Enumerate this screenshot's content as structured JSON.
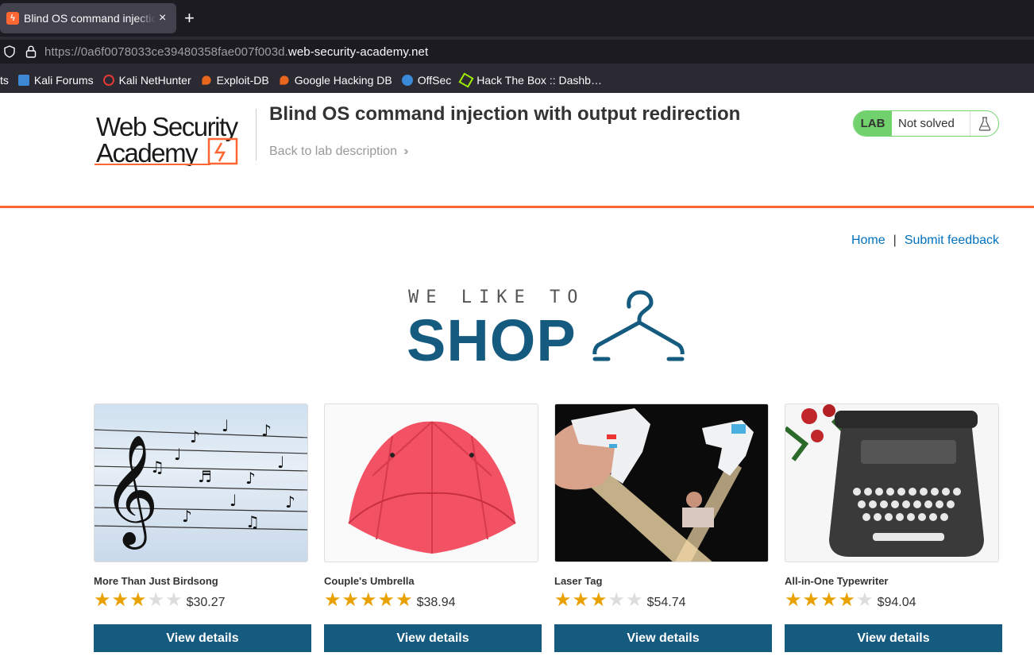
{
  "browser": {
    "tab_title": "Blind OS command injection with output redirection",
    "tab_close": "×",
    "new_tab": "+",
    "url_prefix": "https://0a6f0078033ce39480358fae007f003d.",
    "url_domain": "web-security-academy.net",
    "bookmarks": [
      {
        "label": "Kali Forums",
        "icon": "kali-forums-icon",
        "color": "#3d88d3"
      },
      {
        "label": "Kali NetHunter",
        "icon": "kali-nethunter-icon",
        "color": "#e53935"
      },
      {
        "label": "Exploit-DB",
        "icon": "exploit-db-icon",
        "color": "#e8661d"
      },
      {
        "label": "Google Hacking DB",
        "icon": "google-hacking-db-icon",
        "color": "#e8661d"
      },
      {
        "label": "OffSec",
        "icon": "offsec-icon",
        "color": "#3b8ad8"
      },
      {
        "label": "Hack The Box :: Dashb…",
        "icon": "hack-the-box-icon",
        "color": "#9fef00"
      }
    ],
    "bookmarks_clipped": "ts"
  },
  "lab": {
    "logo_line1": "Web Security",
    "logo_line2": "Academy",
    "title": "Blind OS command injection with output redirection",
    "back_link": "Back to lab description",
    "status_badge": "LAB",
    "status_text": "Not solved",
    "accent": "#ff6633"
  },
  "nav": {
    "home": "Home",
    "separator": "|",
    "feedback": "Submit feedback"
  },
  "banner": {
    "line1": "WE LIKE TO",
    "line2": "SHOP"
  },
  "products": [
    {
      "name": "More Than Just Birdsong",
      "stars": 3,
      "price": "$30.27",
      "button": "View details"
    },
    {
      "name": "Couple's Umbrella",
      "stars": 5,
      "price": "$38.94",
      "button": "View details"
    },
    {
      "name": "Laser Tag",
      "stars": 3,
      "price": "$54.74",
      "button": "View details"
    },
    {
      "name": "All-in-One Typewriter",
      "stars": 4,
      "price": "$94.04",
      "button": "View details"
    }
  ]
}
